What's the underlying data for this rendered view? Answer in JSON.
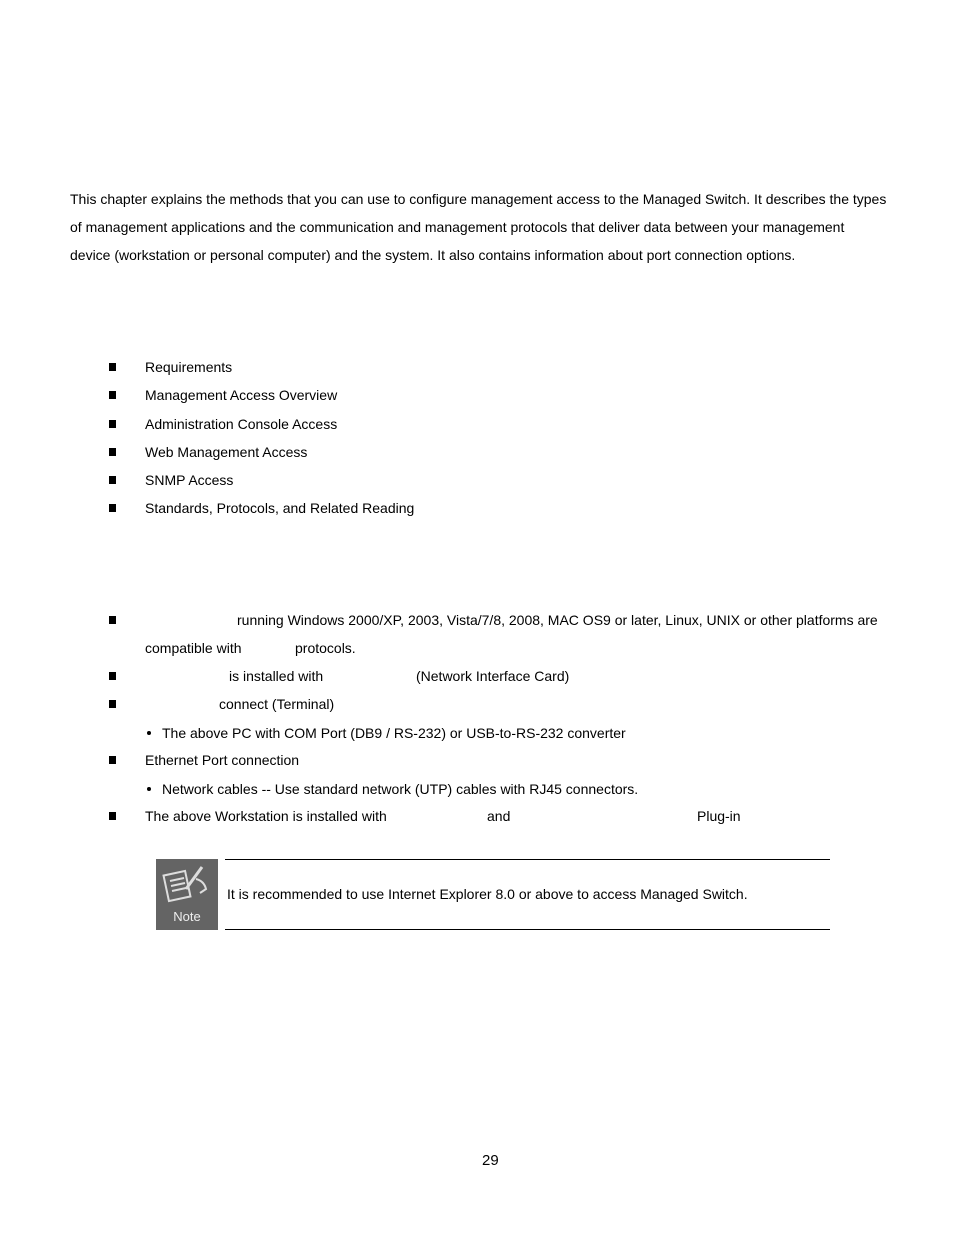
{
  "intro": [
    "This chapter explains the methods that you can use to configure management access to the Managed Switch. It describes the types",
    "of management applications and the communication and management protocols that deliver data between your management",
    "device (workstation or personal computer) and the system. It also contains information about port connection options."
  ],
  "topics": [
    "Requirements",
    "Management Access Overview",
    "Administration Console Access",
    "Web Management Access",
    "SNMP Access",
    "Standards, Protocols, and Related Reading"
  ],
  "requirements": {
    "r1a": "running Windows 2000/XP, 2003, Vista/7/8, 2008, MAC OS9 or later, Linux, UNIX or other platforms are",
    "r1b": "compatible with",
    "r1c": "protocols.",
    "r2a": "is installed with",
    "r2b": "(Network Interface Card)",
    "r3": "connect (Terminal)",
    "r3_sub": "The above PC with COM Port (DB9 / RS-232) or USB-to-RS-232 converter",
    "r4": "Ethernet Port connection",
    "r4_sub": "Network cables -- Use standard network (UTP) cables with RJ45 connectors.",
    "r5a": "The above Workstation is installed with",
    "r5b": "and",
    "r5c": "Plug-in"
  },
  "note": {
    "icon_label": "Note",
    "text": "It is recommended to use Internet Explorer 8.0 or above to access Managed Switch."
  },
  "page_number": "29"
}
